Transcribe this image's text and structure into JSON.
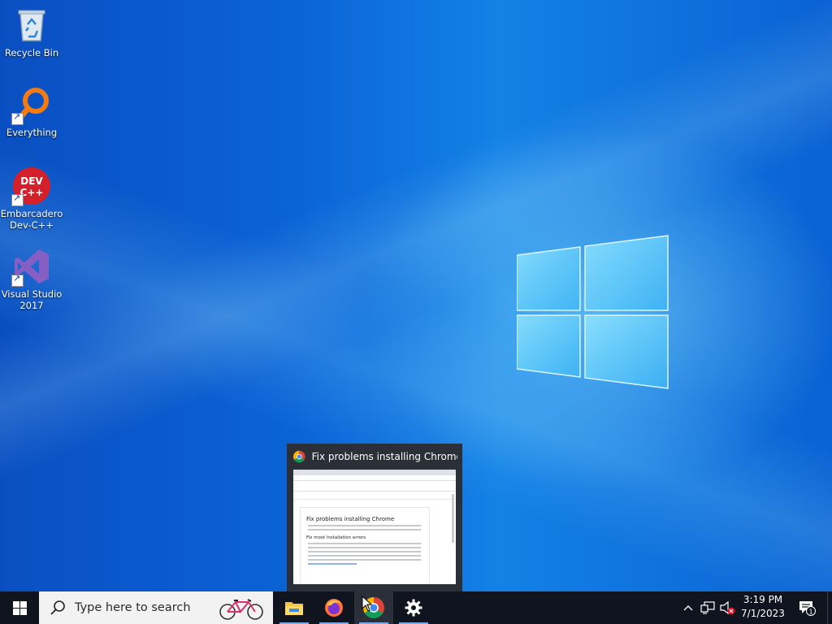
{
  "desktop": {
    "icons": [
      {
        "label": "Recycle Bin",
        "icon": "recycle-bin-icon"
      },
      {
        "label": "Everything",
        "icon": "everything-search-icon"
      },
      {
        "label_line1": "Embarcadero",
        "label_line2": "Dev-C++",
        "icon": "dev-cpp-icon"
      },
      {
        "label_line1": "Visual Studio",
        "label_line2": "2017",
        "icon": "visual-studio-icon"
      }
    ],
    "wallpaper": "windows-10-default"
  },
  "thumbnail": {
    "title": "Fix problems installing Chrome...",
    "page": {
      "heading": "Fix problems installing Chrome",
      "subheading": "Fix most installation errors"
    }
  },
  "taskbar": {
    "search_placeholder": "Type here to search",
    "apps": [
      "file-explorer-icon",
      "firefox-icon",
      "chrome-icon",
      "settings-gear-icon"
    ],
    "clock": {
      "time": "3:19 PM",
      "date": "7/1/2023"
    },
    "notification_count": "1"
  },
  "colors": {
    "taskbar_bg": "#10141f",
    "desktop_blue": "#0b63d6",
    "active_underline": "#7aa9e6"
  }
}
